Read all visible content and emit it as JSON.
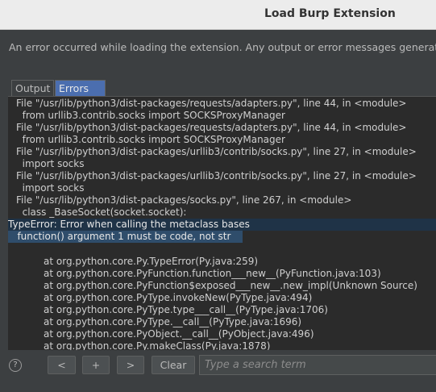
{
  "window": {
    "title": "Load Burp Extension"
  },
  "message": "An error occurred while loading the extension. Any output or error messages generated",
  "tabs": [
    {
      "label": "Output",
      "active": false
    },
    {
      "label": "Errors",
      "active": true
    }
  ],
  "log_lines": [
    "File \"/usr/lib/python3/dist-packages/requests/adapters.py\", line 44, in <module>",
    "  from urllib3.contrib.socks import SOCKSProxyManager",
    "File \"/usr/lib/python3/dist-packages/requests/adapters.py\", line 44, in <module>",
    "  from urllib3.contrib.socks import SOCKSProxyManager",
    "File \"/usr/lib/python3/dist-packages/urllib3/contrib/socks.py\", line 27, in <module>",
    "  import socks",
    "File \"/usr/lib/python3/dist-packages/urllib3/contrib/socks.py\", line 27, in <module>",
    "  import socks",
    "File \"/usr/lib/python3/dist-packages/socks.py\", line 267, in <module>",
    "  class _BaseSocket(socket.socket):",
    "TypeError: Error when calling the metaclass bases",
    "   function() argument 1 must be code, not str",
    "",
    "",
    "at org.python.core.Py.TypeError(Py.java:259)",
    "at org.python.core.PyFunction.function___new__(PyFunction.java:103)",
    "at org.python.core.PyFunction$exposed___new__.new_impl(Unknown Source)",
    "at org.python.core.PyType.invokeNew(PyType.java:494)",
    "at org.python.core.PyType.type___call__(PyType.java:1706)",
    "at org.python.core.PyType.__call__(PyType.java:1696)",
    "at org.python.core.PyObject.__call__(PyObject.java:496)",
    "at org.python.core.Py.makeClass(Py.java:1878)"
  ],
  "toolbar": {
    "help_label": "?",
    "prev_label": "<",
    "add_label": "+",
    "next_label": ">",
    "clear_label": "Clear",
    "search_placeholder": "Type a search term"
  },
  "colors": {
    "background": "#3c3f41",
    "log_background": "#2b2b2b",
    "active_tab": "#4b6eaf",
    "error_highlight": "#1f3347"
  }
}
